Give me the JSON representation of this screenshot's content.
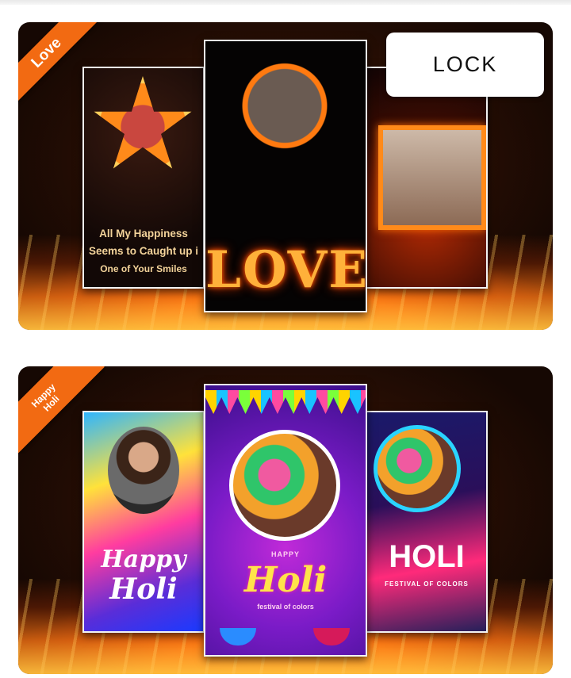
{
  "cards": [
    {
      "badge": "Love",
      "panels": {
        "left_caption": [
          "All My Happiness",
          "Seems to Caught up i",
          "One of Your Smiles"
        ],
        "center_word": "LOVE"
      }
    },
    {
      "badge_line1": "Happy",
      "badge_line2": "Holi",
      "panels": {
        "left_word_top": "Happy",
        "left_word_bottom": "Holi",
        "center_happy": "HAPPY",
        "center_word": "Holi",
        "center_sub": "festival of colors",
        "right_word": "HOLI",
        "right_sub": "FESTIVAL OF COLORS"
      }
    }
  ],
  "lock_button": {
    "label": "LOCK"
  }
}
